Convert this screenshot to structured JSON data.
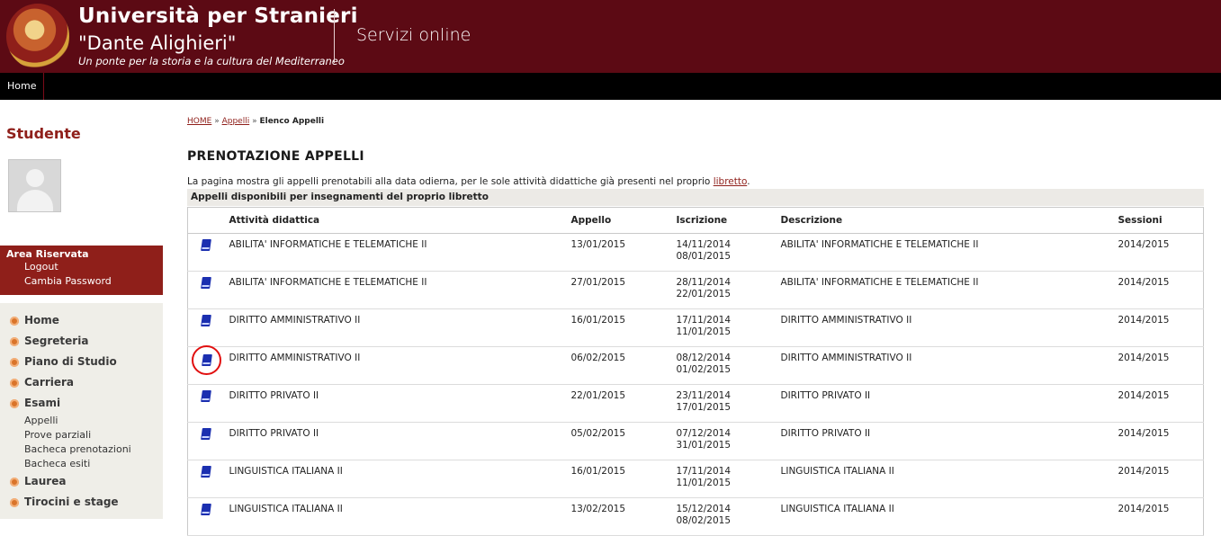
{
  "header": {
    "university": "Università per Stranieri",
    "university_sub": "\"Dante Alighieri\"",
    "motto": "Un ponte per la storia e la cultura del Mediterraneo",
    "service": "Servizi online"
  },
  "topnav": {
    "home": "Home"
  },
  "sidebar": {
    "title": "Studente",
    "area": {
      "title": "Area Riservata",
      "links": [
        "Logout",
        "Cambia Password"
      ]
    },
    "menu": [
      {
        "label": "Home"
      },
      {
        "label": "Segreteria"
      },
      {
        "label": "Piano di Studio"
      },
      {
        "label": "Carriera"
      },
      {
        "label": "Esami",
        "sub": [
          "Appelli",
          "Prove parziali",
          "Bacheca prenotazioni",
          "Bacheca esiti"
        ]
      },
      {
        "label": "Laurea"
      },
      {
        "label": "Tirocini e stage"
      }
    ]
  },
  "breadcrumb": {
    "home": "HOME",
    "appelli": "Appelli",
    "current": "Elenco Appelli",
    "sep": "»"
  },
  "page": {
    "title": "PRENOTAZIONE APPELLI",
    "intro": "La pagina mostra gli appelli prenotabili alla data odierna, per le sole attività didattiche già presenti nel proprio",
    "intro_link": "libretto",
    "section": "Appelli disponibili per insegnamenti del proprio libretto"
  },
  "table": {
    "headers": [
      "Attività didattica",
      "Appello",
      "Iscrizione",
      "Descrizione",
      "Sessioni"
    ],
    "rows": [
      {
        "attivita": "ABILITA' INFORMATICHE E TELEMATICHE II",
        "appello": "13/01/2015",
        "iscr_from": "14/11/2014",
        "iscr_to": "08/01/2015",
        "descrizione": "ABILITA' INFORMATICHE E TELEMATICHE II",
        "sessioni": "2014/2015"
      },
      {
        "attivita": "ABILITA' INFORMATICHE E TELEMATICHE II",
        "appello": "27/01/2015",
        "iscr_from": "28/11/2014",
        "iscr_to": "22/01/2015",
        "descrizione": "ABILITA' INFORMATICHE E TELEMATICHE II",
        "sessioni": "2014/2015"
      },
      {
        "attivita": "DIRITTO AMMINISTRATIVO II",
        "appello": "16/01/2015",
        "iscr_from": "17/11/2014",
        "iscr_to": "11/01/2015",
        "descrizione": "DIRITTO AMMINISTRATIVO II",
        "sessioni": "2014/2015"
      },
      {
        "attivita": "DIRITTO AMMINISTRATIVO II",
        "appello": "06/02/2015",
        "iscr_from": "08/12/2014",
        "iscr_to": "01/02/2015",
        "descrizione": "DIRITTO AMMINISTRATIVO II",
        "sessioni": "2014/2015",
        "highlighted": true
      },
      {
        "attivita": "DIRITTO PRIVATO II",
        "appello": "22/01/2015",
        "iscr_from": "23/11/2014",
        "iscr_to": "17/01/2015",
        "descrizione": "DIRITTO PRIVATO II",
        "sessioni": "2014/2015"
      },
      {
        "attivita": "DIRITTO PRIVATO II",
        "appello": "05/02/2015",
        "iscr_from": "07/12/2014",
        "iscr_to": "31/01/2015",
        "descrizione": "DIRITTO PRIVATO II",
        "sessioni": "2014/2015"
      },
      {
        "attivita": "LINGUISTICA ITALIANA II",
        "appello": "16/01/2015",
        "iscr_from": "17/11/2014",
        "iscr_to": "11/01/2015",
        "descrizione": "LINGUISTICA ITALIANA II",
        "sessioni": "2014/2015"
      },
      {
        "attivita": "LINGUISTICA ITALIANA II",
        "appello": "13/02/2015",
        "iscr_from": "15/12/2014",
        "iscr_to": "08/02/2015",
        "descrizione": "LINGUISTICA ITALIANA II",
        "sessioni": "2014/2015"
      }
    ]
  },
  "colors": {
    "brand": "#5c0a14",
    "accent": "#8f1f1a",
    "icon": "#1b2fb0",
    "highlight": "#e10f0f"
  },
  "icons": {
    "row_action": "book-icon",
    "menu_bullet": "bullet-icon"
  }
}
